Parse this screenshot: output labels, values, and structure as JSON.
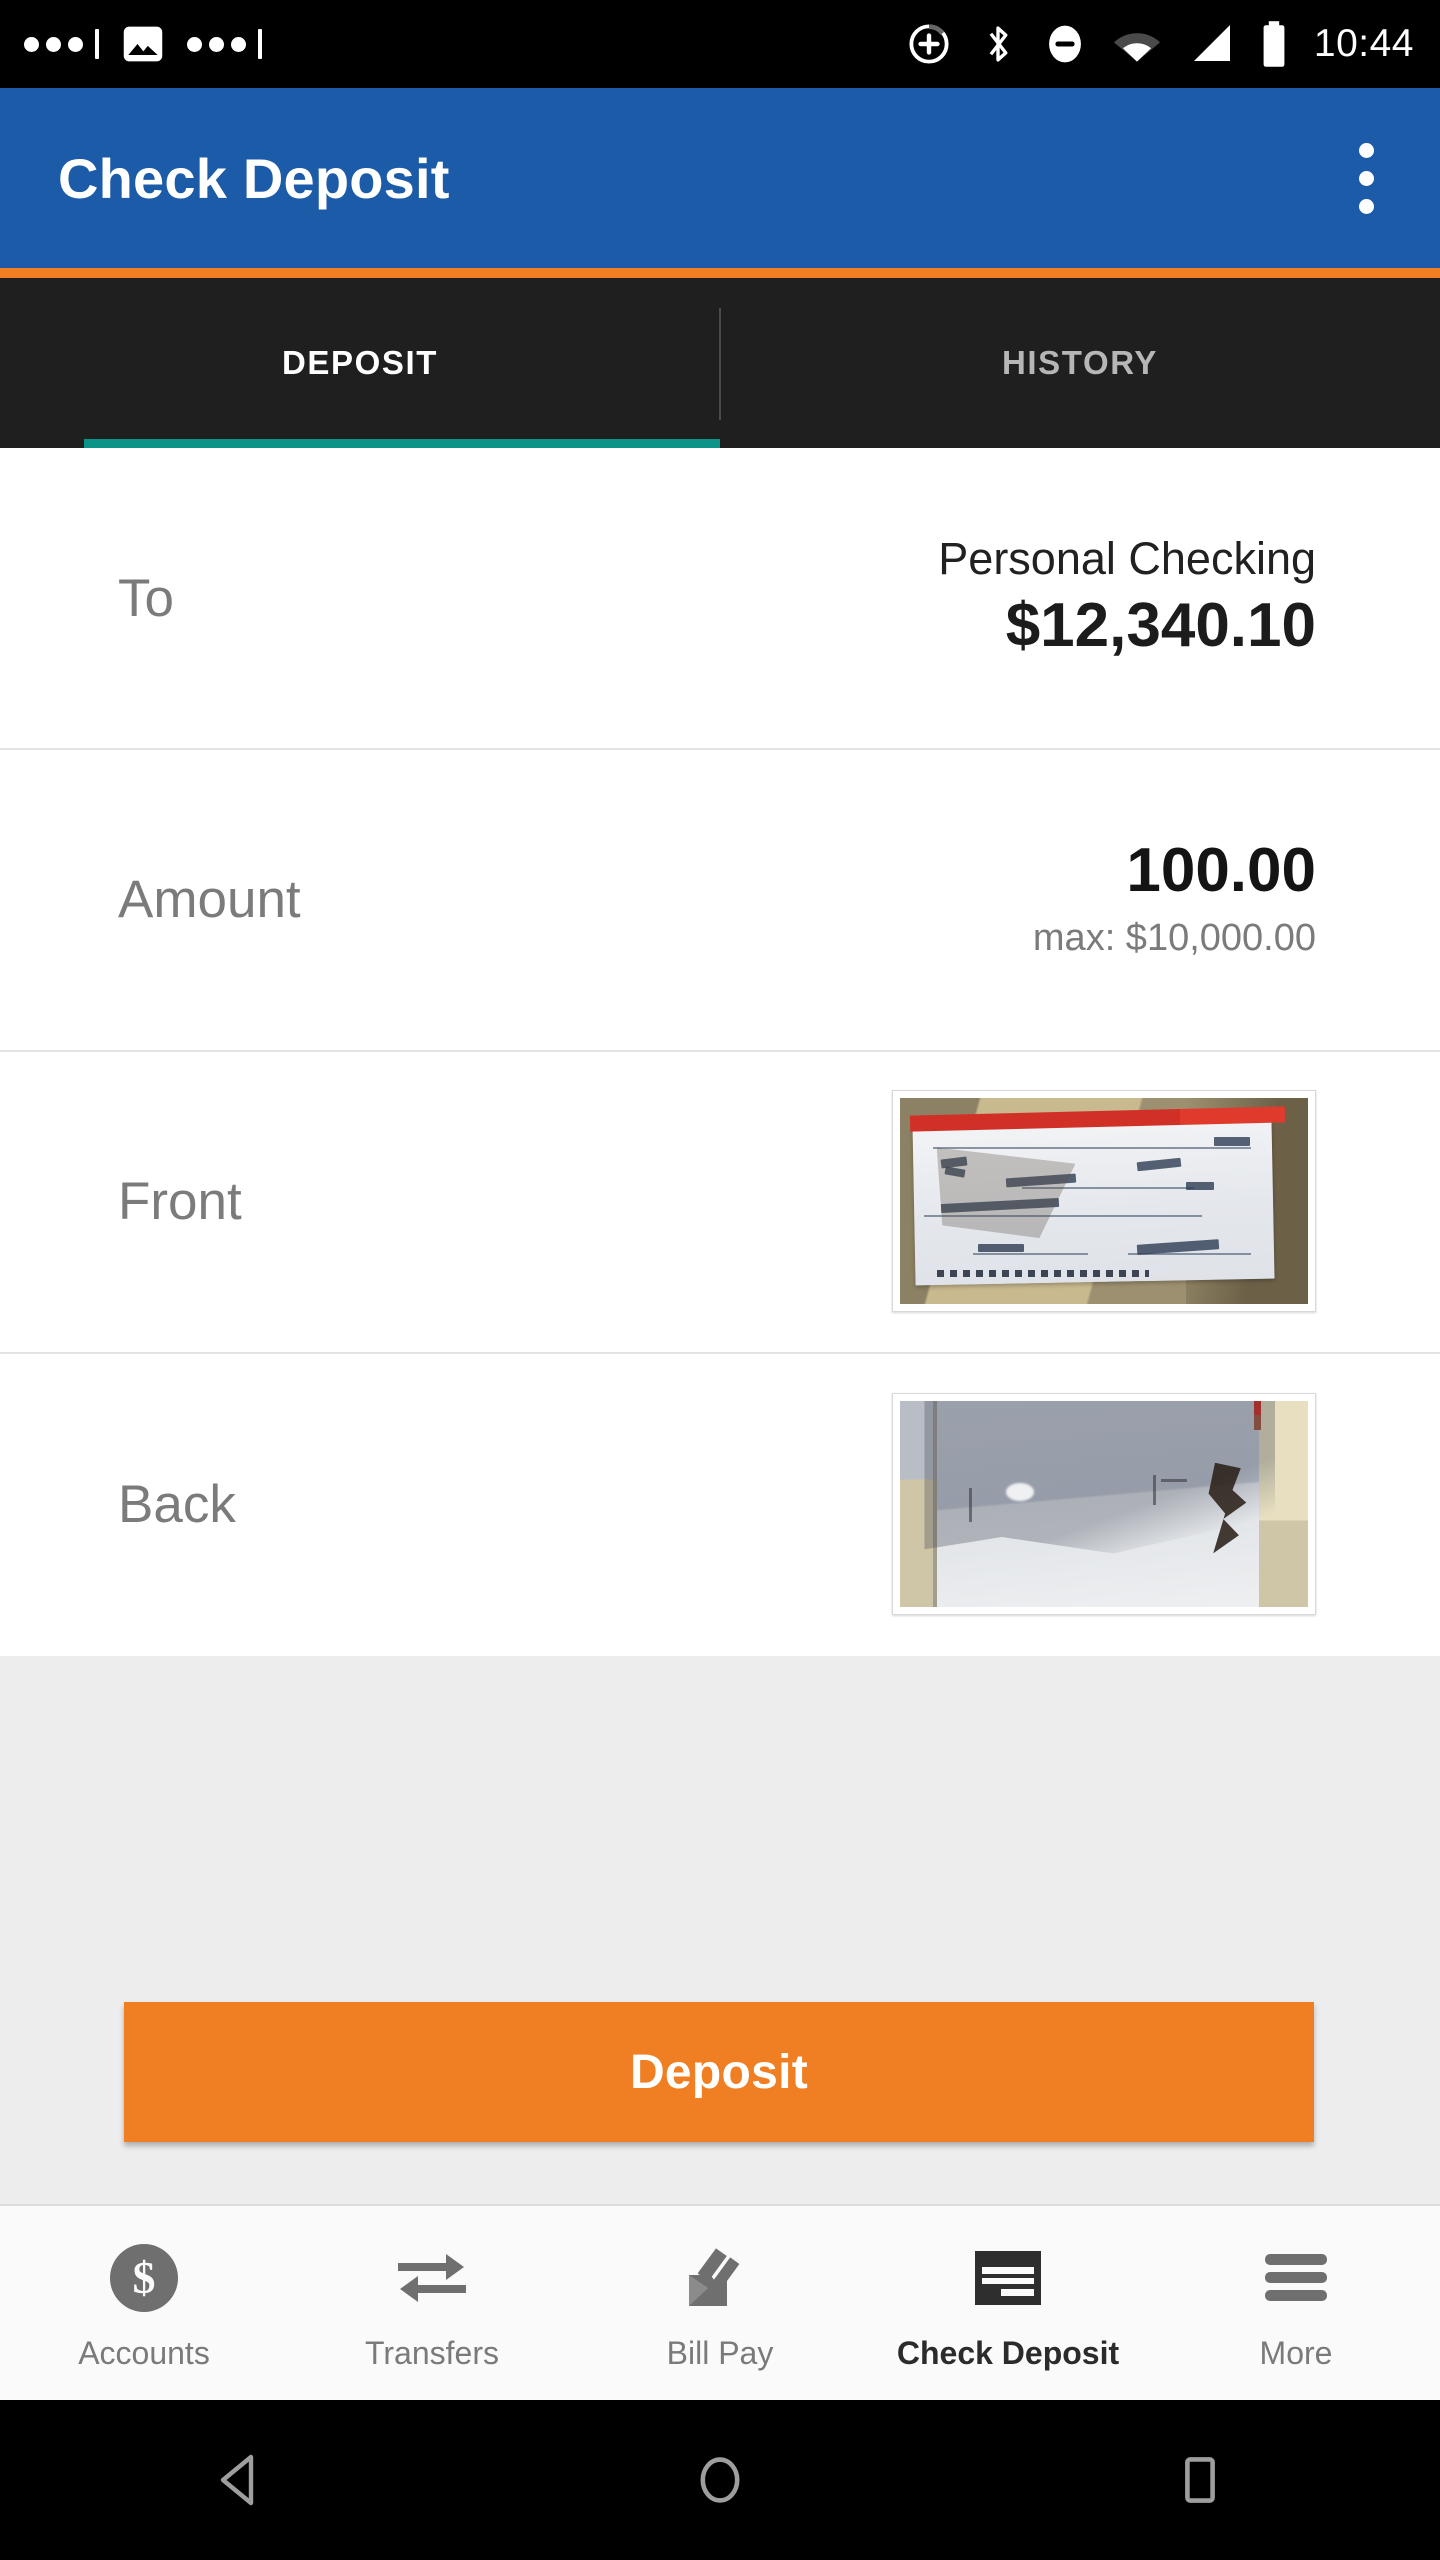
{
  "status_bar": {
    "time": "10:44",
    "left_icons": [
      "notification-dots",
      "image-icon",
      "notification-dots"
    ],
    "right_icons": [
      "add-circle-icon",
      "bluetooth-icon",
      "do-not-disturb-icon",
      "wifi-icon",
      "cellular-signal-icon",
      "battery-icon"
    ]
  },
  "app_bar": {
    "title": "Check Deposit",
    "overflow_label": "overflow-menu",
    "background_color": "#1C5BA8",
    "accent_color": "#EF7F22"
  },
  "tabs": {
    "items": [
      {
        "label": "DEPOSIT",
        "active": true
      },
      {
        "label": "HISTORY",
        "active": false
      }
    ],
    "indicator_color": "#0B9488",
    "background_color": "#1F1F1F"
  },
  "form": {
    "rows": [
      {
        "label": "To",
        "account_name": "Personal Checking",
        "balance": "$12,340.10"
      },
      {
        "label": "Amount",
        "value": "100.00",
        "hint": "max: $10,000.00"
      },
      {
        "label": "Front",
        "image_alt": "check-front-photo"
      },
      {
        "label": "Back",
        "image_alt": "check-back-photo"
      }
    ]
  },
  "cta": {
    "deposit_label": "Deposit",
    "color": "#EF7F22"
  },
  "bottom_nav": {
    "items": [
      {
        "label": "Accounts",
        "icon": "dollar-circle-icon",
        "active": false
      },
      {
        "label": "Transfers",
        "icon": "transfer-arrows-icon",
        "active": false
      },
      {
        "label": "Bill Pay",
        "icon": "envelope-pen-icon",
        "active": false
      },
      {
        "label": "Check Deposit",
        "icon": "check-icon",
        "active": true
      },
      {
        "label": "More",
        "icon": "hamburger-icon",
        "active": false
      }
    ]
  },
  "android_nav": {
    "buttons": [
      "back-button",
      "home-button",
      "recents-button"
    ]
  }
}
